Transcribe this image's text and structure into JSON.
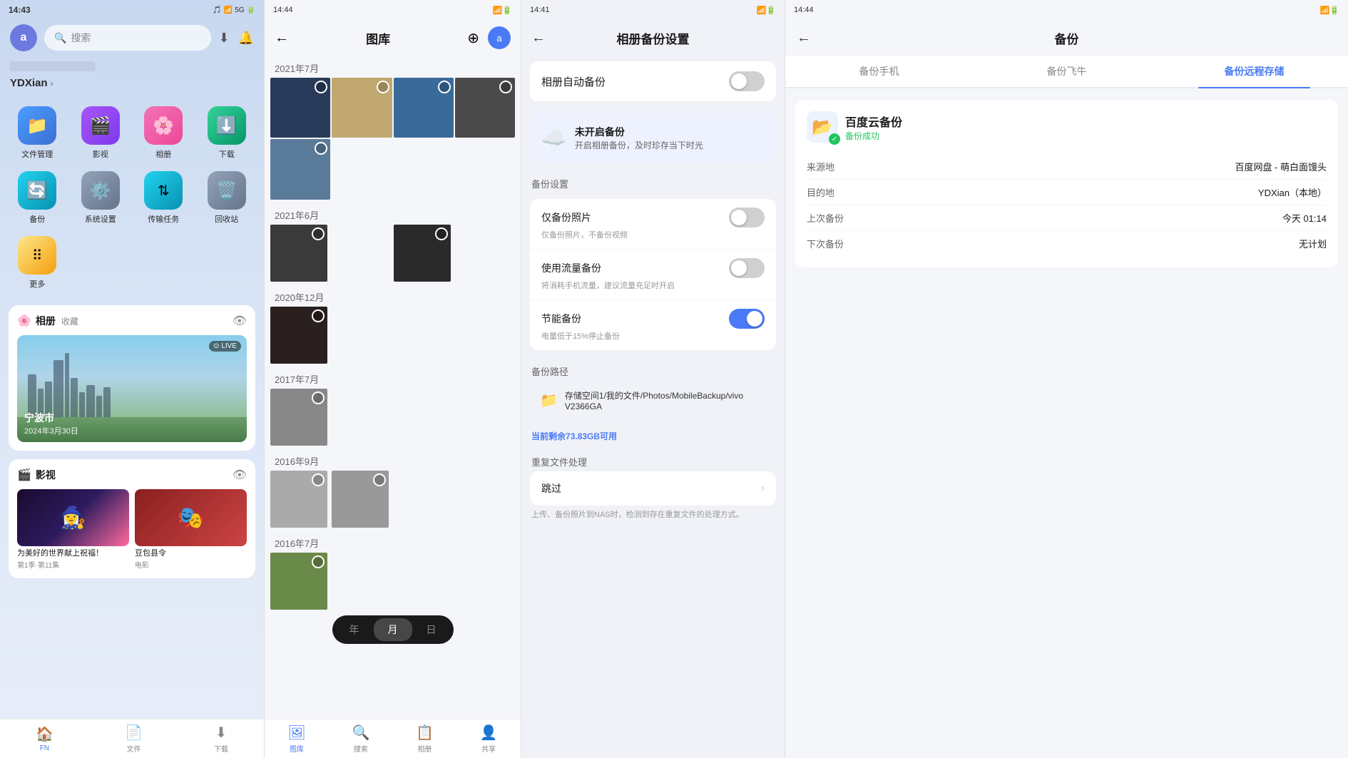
{
  "panel1": {
    "statusTime": "14:43",
    "statusIcons": "🎵 📶 🔋",
    "avatar": "a",
    "searchPlaceholder": "搜索",
    "username": "YDXian",
    "apps": [
      {
        "name": "文件管理",
        "icon": "📁",
        "color": "blue"
      },
      {
        "name": "影视",
        "icon": "🎬",
        "color": "purple"
      },
      {
        "name": "相册",
        "icon": "🌸",
        "color": "pink"
      },
      {
        "name": "下载",
        "icon": "⬇️",
        "color": "green"
      },
      {
        "name": "备份",
        "icon": "🔄",
        "color": "cyan"
      },
      {
        "name": "系统设置",
        "icon": "⚙️",
        "color": "gray"
      },
      {
        "name": "传输任务",
        "icon": "↕️",
        "color": "cyan"
      },
      {
        "name": "回收站",
        "icon": "🗑️",
        "color": "gray"
      },
      {
        "name": "更多",
        "icon": "⠿",
        "color": "multi"
      }
    ],
    "albumSection": {
      "title": "相册",
      "subtitle": "收藏",
      "photoLocation": "宁波市",
      "photoDate": "2024年3月30日",
      "liveBadge": "⊙ LIVE"
    },
    "videoSection": {
      "title": "影视",
      "videos": [
        {
          "title": "为美好的世界献上祝福！",
          "sub": "第1季·第11集"
        },
        {
          "title": "豆包县令",
          "sub": "电影"
        }
      ]
    },
    "bottomNav": [
      {
        "icon": "🏠",
        "label": "FN",
        "active": true
      },
      {
        "icon": "📄",
        "label": "文件",
        "active": false
      },
      {
        "icon": "⬇",
        "label": "下载",
        "active": false
      }
    ]
  },
  "panel2": {
    "statusTime": "14:44",
    "title": "图库",
    "months": [
      {
        "label": "2021年7月",
        "count": 5
      },
      {
        "label": "2021年6月",
        "count": 2
      },
      {
        "label": "2020年12月",
        "count": 1
      },
      {
        "label": "2017年7月",
        "count": 1
      },
      {
        "label": "2016年9月",
        "count": 2
      },
      {
        "label": "2016年7月",
        "count": 1
      }
    ],
    "tabs": [
      {
        "label": "年",
        "active": false
      },
      {
        "label": "月",
        "active": true
      },
      {
        "label": "日",
        "active": false
      }
    ],
    "bottomNav": [
      {
        "icon": "🖼",
        "label": "图库",
        "active": true
      },
      {
        "icon": "🔍",
        "label": "搜索",
        "active": false
      },
      {
        "icon": "📋",
        "label": "相册",
        "active": false
      },
      {
        "icon": "👤",
        "label": "共享",
        "active": false
      }
    ]
  },
  "panel3": {
    "statusTime": "14:41",
    "title": "相册备份设置",
    "autoBackup": {
      "label": "相册自动备份",
      "enabled": false
    },
    "prompt": {
      "title": "未开启备份",
      "sub": "开启相册备份，及时珍存当下时光"
    },
    "backupSettings": {
      "sectionLabel": "备份设置",
      "photoOnly": {
        "label": "仅备份照片",
        "sub": "仅备份照片，不备份视频",
        "enabled": false
      },
      "useCellular": {
        "label": "使用流量备份",
        "sub": "将消耗手机流量，建议流量充足时开启",
        "enabled": false
      },
      "energySaving": {
        "label": "节能备份",
        "sub": "电量低于15%停止备份",
        "enabled": true
      }
    },
    "backupPath": {
      "sectionLabel": "备份路径",
      "path": "存储空间1/我的文件/Photos/MobileBackup/vivo V2366GA"
    },
    "storageInfo": "当前剩余73.83GB可用",
    "storageHighlight": "73.83GB",
    "duplicate": {
      "sectionLabel": "重复文件处理",
      "label": "跳过",
      "hint": "上传、备份照片到NAS时，检测到存在重复文件的处理方式。"
    }
  },
  "panel4": {
    "statusTime": "14:44",
    "title": "备份",
    "tabs": [
      {
        "label": "备份手机",
        "active": false
      },
      {
        "label": "备份飞牛",
        "active": false
      },
      {
        "label": "备份远程存储",
        "active": true
      }
    ],
    "backupItem": {
      "name": "百度云备份",
      "statusText": "备份成功",
      "details": [
        {
          "label": "来源地",
          "value": "百度网盘 - 萌白面馒头"
        },
        {
          "label": "目的地",
          "value": "YDXian（本地）"
        },
        {
          "label": "上次备份",
          "value": "今天 01:14"
        },
        {
          "label": "下次备份",
          "value": "无计划"
        }
      ]
    }
  }
}
